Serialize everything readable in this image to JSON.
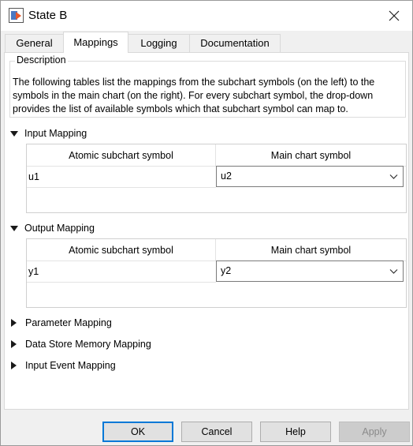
{
  "window": {
    "title": "State B"
  },
  "tabs": [
    {
      "label": "General"
    },
    {
      "label": "Mappings"
    },
    {
      "label": "Logging"
    },
    {
      "label": "Documentation"
    }
  ],
  "description": {
    "legend": "Description",
    "text": "The following tables list the mappings from the subchart symbols (on the left) to the symbols in the main chart (on the right). For every subchart symbol, the drop-down provides the list of available symbols which that subchart symbol can map to."
  },
  "input_mapping": {
    "label": "Input Mapping",
    "col_left": "Atomic subchart symbol",
    "col_right": "Main chart symbol",
    "rows": [
      {
        "subchart": "u1",
        "main": "u2"
      }
    ]
  },
  "output_mapping": {
    "label": "Output Mapping",
    "col_left": "Atomic subchart symbol",
    "col_right": "Main chart symbol",
    "rows": [
      {
        "subchart": "y1",
        "main": "y2"
      }
    ]
  },
  "collapsed_sections": [
    {
      "label": "Parameter Mapping"
    },
    {
      "label": "Data Store Memory Mapping"
    },
    {
      "label": "Input Event Mapping"
    }
  ],
  "buttons": {
    "ok": "OK",
    "cancel": "Cancel",
    "help": "Help",
    "apply": "Apply"
  },
  "colors": {
    "accent": "#0078d7"
  }
}
